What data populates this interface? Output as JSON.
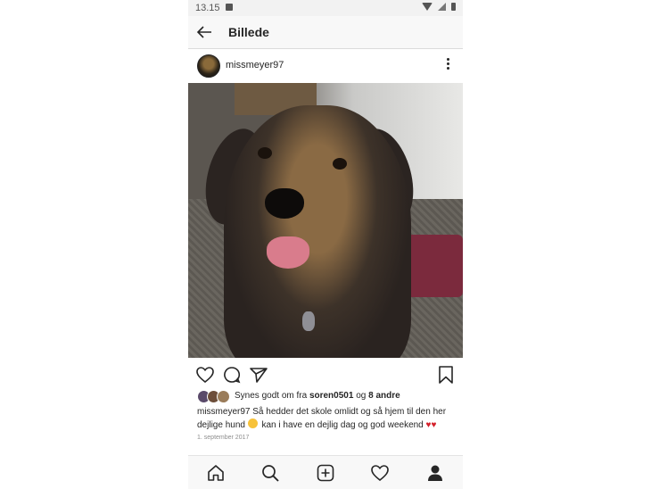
{
  "status_bar": {
    "time": "13.15",
    "icons": [
      "image-icon",
      "wifi-icon",
      "signal-icon",
      "battery-icon"
    ]
  },
  "top_bar": {
    "title": "Billede",
    "back_icon": "arrow-left-icon"
  },
  "post": {
    "username": "missmeyer97",
    "menu_icon": "more-vertical-icon",
    "likes": {
      "prefix": "Synes godt om fra ",
      "user": "soren0501",
      "middle": " og ",
      "others": "8 andre"
    },
    "caption": {
      "username": "missmeyer97",
      "text_1": " Så hedder det skole omlidt og så hjem til den her dejlige hund ",
      "text_2": " kan i have en dejlig dag og god weekend ",
      "hearts": "♥♥"
    },
    "date": "1. september 2017"
  },
  "actions": [
    "heart-icon",
    "comment-icon",
    "send-icon",
    "bookmark-icon"
  ],
  "bottom_nav": [
    "home-icon",
    "search-icon",
    "add-post-icon",
    "activity-heart-icon",
    "profile-icon"
  ],
  "colors": {
    "text": "#262626",
    "secondary": "#8e8e8e",
    "heart": "#d4202a"
  }
}
